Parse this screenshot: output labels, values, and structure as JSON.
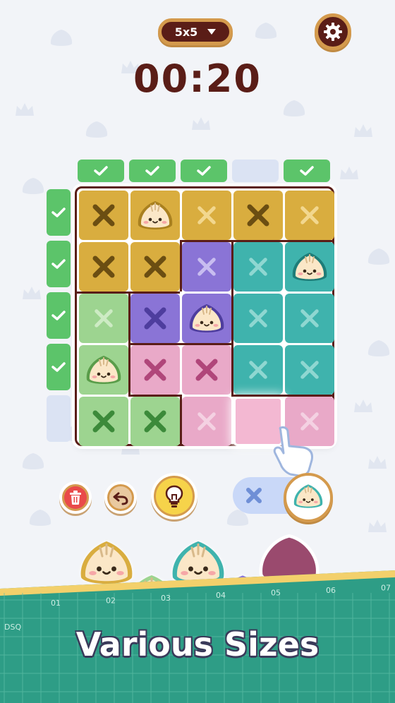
{
  "header": {
    "size_value": "5x5",
    "timer": "00:20"
  },
  "icons": {
    "settings": "gear-icon",
    "size_dropdown": "chevron-down-icon",
    "delete": "trash-icon",
    "undo": "undo-icon",
    "hint": "lightbulb-icon",
    "check": "check-icon",
    "mark": "x-icon",
    "piece": "dumpling-icon",
    "pointer": "hand-pointer-icon"
  },
  "column_status": [
    "complete",
    "complete",
    "complete",
    "pending",
    "complete"
  ],
  "row_status": [
    "complete",
    "complete",
    "complete",
    "complete",
    "pending"
  ],
  "grid": {
    "size": 5,
    "cells": [
      [
        "x",
        "piece",
        "x-light",
        "x",
        "x-light"
      ],
      [
        "x",
        "x",
        "x-light",
        "x-light",
        "piece"
      ],
      [
        "x-light",
        "x",
        "piece",
        "x-light",
        "x-light"
      ],
      [
        "piece",
        "x",
        "x",
        "x-light",
        "x-light"
      ],
      [
        "x",
        "x",
        "x-light",
        "empty",
        "x-light"
      ]
    ],
    "regions": [
      [
        "yellow",
        "yellow",
        "yellow",
        "yellow",
        "yellow"
      ],
      [
        "yellow",
        "yellow",
        "purple",
        "teal",
        "teal"
      ],
      [
        "green",
        "purple",
        "purple",
        "teal",
        "teal"
      ],
      [
        "green",
        "pink",
        "pink",
        "teal",
        "teal"
      ],
      [
        "green",
        "green",
        "pink",
        "pink",
        "pink"
      ]
    ]
  },
  "colors": {
    "yellow": "#d9ad3f",
    "purple": "#8a74d6",
    "teal": "#3fb3ad",
    "green": "#9dd490",
    "pink": "#e9a9c8",
    "mark_yellow": "#6b4e12",
    "mark_purple": "#4e3d9e",
    "mark_teal": "#c7ede9",
    "mark_green": "#3c8a3a",
    "mark_pink": "#b0467a",
    "brown": "#5a1d17",
    "gold": "#d49a4d"
  },
  "input_mode": {
    "options": [
      "mark",
      "piece"
    ],
    "selected": "piece"
  },
  "footer": {
    "ruler_numbers": [
      "01",
      "02",
      "03",
      "04",
      "05",
      "06",
      "07"
    ],
    "ruler_label": "DSQ",
    "title": "Various Sizes"
  }
}
